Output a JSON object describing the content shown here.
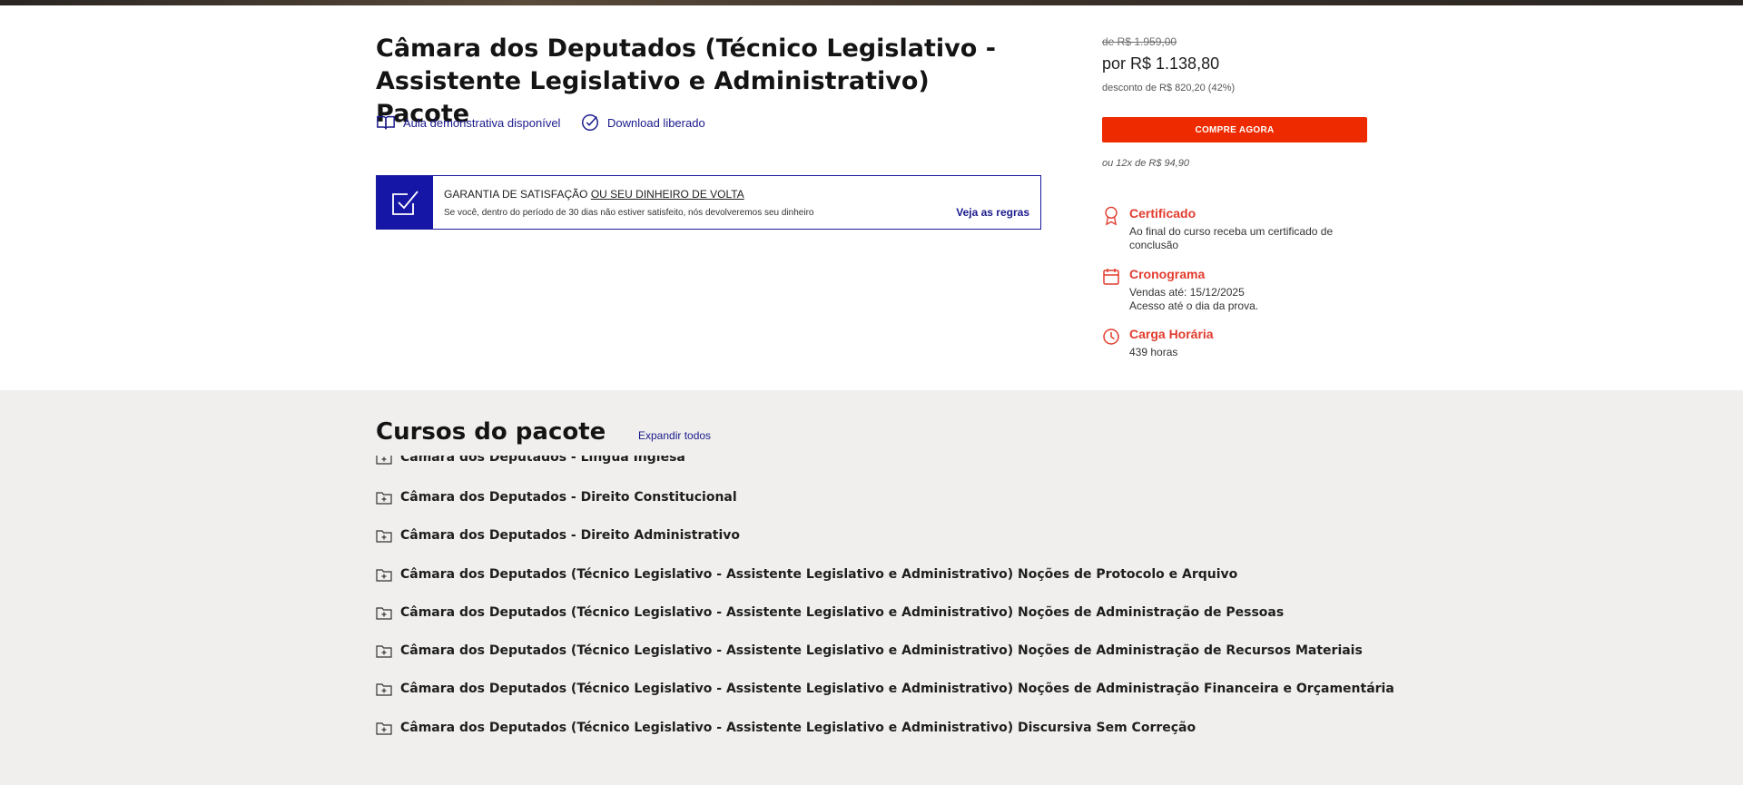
{
  "product": {
    "title": "Câmara dos Deputados (Técnico Legislativo - Assistente Legislativo e Administrativo) Pacote",
    "features": [
      {
        "label": "Aula demonstrativa disponível",
        "icon": "book-open-icon"
      },
      {
        "label": "Download liberado",
        "icon": "check-circle-icon"
      }
    ]
  },
  "guarantee": {
    "title_prefix": "GARANTIA DE SATISFAÇÃO ",
    "title_underlined": "OU SEU DINHEIRO DE VOLTA",
    "text": "Se você, dentro do período de 30 dias não estiver satisfeito, nós devolveremos seu dinheiro",
    "link": "Veja as regras"
  },
  "pricing": {
    "old_price": "de R$ 1.959,00",
    "price": "por R$ 1.138,80",
    "discount": "desconto de R$ 820,20 (42%)",
    "buy_label": "COMPRE AGORA",
    "installments": "ou 12x de R$ 94,90"
  },
  "info": {
    "certificate": {
      "label": "Certificado",
      "text": "Ao final do curso receba um certificado de conclusão",
      "icon": "award-icon"
    },
    "schedule": {
      "label": "Cronograma",
      "line1": "Vendas até: 15/12/2025",
      "line2": "Acesso até o dia da prova.",
      "icon": "calendar-icon"
    },
    "workload": {
      "label": "Carga Horária",
      "text": "439 horas",
      "icon": "clock-icon"
    }
  },
  "courses": {
    "title": "Cursos do pacote",
    "expand_label": "Expandir todos",
    "items": [
      "Câmara dos Deputados - Língua Inglesa",
      "Câmara dos Deputados - Direito Constitucional",
      "Câmara dos Deputados - Direito Administrativo",
      "Câmara dos Deputados (Técnico Legislativo - Assistente Legislativo e Administrativo) Noções de Protocolo e Arquivo",
      "Câmara dos Deputados (Técnico Legislativo - Assistente Legislativo e Administrativo) Noções de Administração de Pessoas",
      "Câmara dos Deputados (Técnico Legislativo - Assistente Legislativo e Administrativo) Noções de Administração de Recursos Materiais",
      "Câmara dos Deputados (Técnico Legislativo - Assistente Legislativo e Administrativo) Noções de Administração Financeira e Orçamentária",
      "Câmara dos Deputados (Técnico Legislativo - Assistente Legislativo e Administrativo) Discursiva Sem Correção"
    ]
  },
  "colors": {
    "accent_blue": "#1616a6",
    "buy_red": "#ee2b00",
    "info_red": "#e23b2e",
    "section_bg": "#f0efed"
  }
}
